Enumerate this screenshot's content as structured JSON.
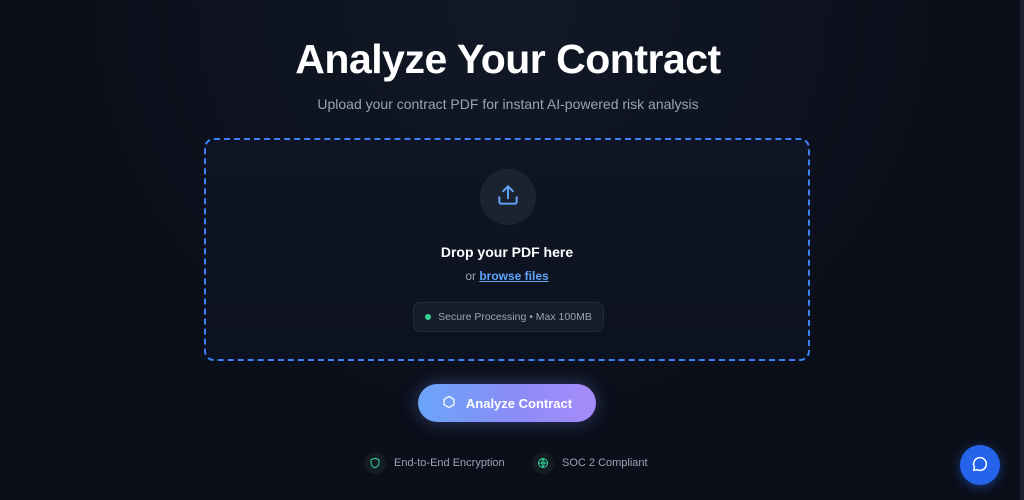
{
  "header": {
    "title": "Analyze Your Contract",
    "subtitle": "Upload your contract PDF for instant AI-powered risk analysis"
  },
  "dropzone": {
    "icon": "upload-icon",
    "title": "Drop your PDF here",
    "or_text": "or",
    "browse_label": "browse files",
    "info_pill": "Secure Processing • Max 100MB"
  },
  "actions": {
    "analyze_label": "Analyze Contract",
    "analyze_icon": "hexagon-icon"
  },
  "badges": [
    {
      "icon": "shield-icon",
      "label": "End-to-End Encryption"
    },
    {
      "icon": "globe-icon",
      "label": "SOC 2 Compliant"
    }
  ],
  "chat": {
    "icon": "chat-bubble-icon"
  },
  "colors": {
    "background": "#0b0f1a",
    "accent_blue": "#3b82f6",
    "link": "#60a5fa",
    "status_green": "#34d399",
    "button_gradient_start": "#6aa5f8",
    "button_gradient_end": "#a78bfa",
    "chat_button": "#2563eb"
  }
}
